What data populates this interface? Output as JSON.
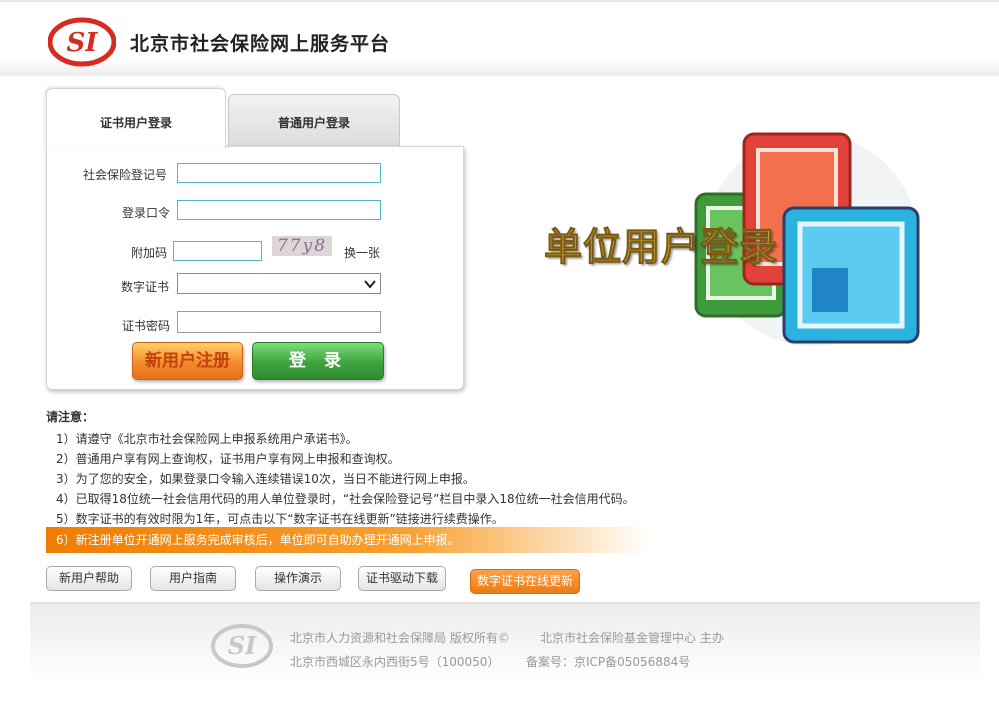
{
  "header": {
    "title": "北京市社会保险网上服务平台",
    "logo_text": "SI"
  },
  "tabs": [
    {
      "label": "证书用户登录",
      "active": true
    },
    {
      "label": "普通用户登录",
      "active": false
    }
  ],
  "form": {
    "ss_number_label": "社会保险登记号",
    "ss_number_value": "",
    "password_label": "登录口令",
    "password_value": "",
    "captcha_label": "附加码",
    "captcha_value": "",
    "captcha_image_text": "77y8",
    "refresh_label": "换一张",
    "cert_label": "数字证书",
    "cert_selected": "",
    "cert_password_label": "证书密码",
    "register_button": "新用户注册",
    "login_button": "登 录"
  },
  "promo": {
    "text": "单位用户登录"
  },
  "notice": {
    "title": "请注意：",
    "items": [
      "1）请遵守《北京市社会保险网上申报系统用户承诺书》。",
      "2）普通用户享有网上查询权，证书用户享有网上申报和查询权。",
      "3）为了您的安全，如果登录口令输入连续错误10次，当日不能进行网上申报。",
      "4）已取得18位统一社会信用代码的用人单位登录时，“社会保险登记号”栏目中录入18位统一社会信用代码。",
      "5）数字证书的有效时限为1年，可点击以下“数字证书在线更新”链接进行续费操作。"
    ],
    "highlight": "6）新注册单位开通网上服务完成审核后，单位即可自助办理开通网上申报。"
  },
  "bottom_buttons": [
    "新用户帮助",
    "用户指南",
    "操作演示",
    "证书驱动下载",
    "数字证书在线更新"
  ],
  "footer": {
    "copyright": "北京市人力资源和社会保障局 版权所有©",
    "host": "北京市社会保险基金管理中心  主办",
    "address": "北京市西城区永内西街5号（100050）",
    "icp": "备案号：京ICP备05056884号"
  },
  "colors": {
    "accent_orange": "#f07d00",
    "login_green": "#3fa33e",
    "input_border": "#57b5c5",
    "logo_red": "#d62b1f"
  }
}
